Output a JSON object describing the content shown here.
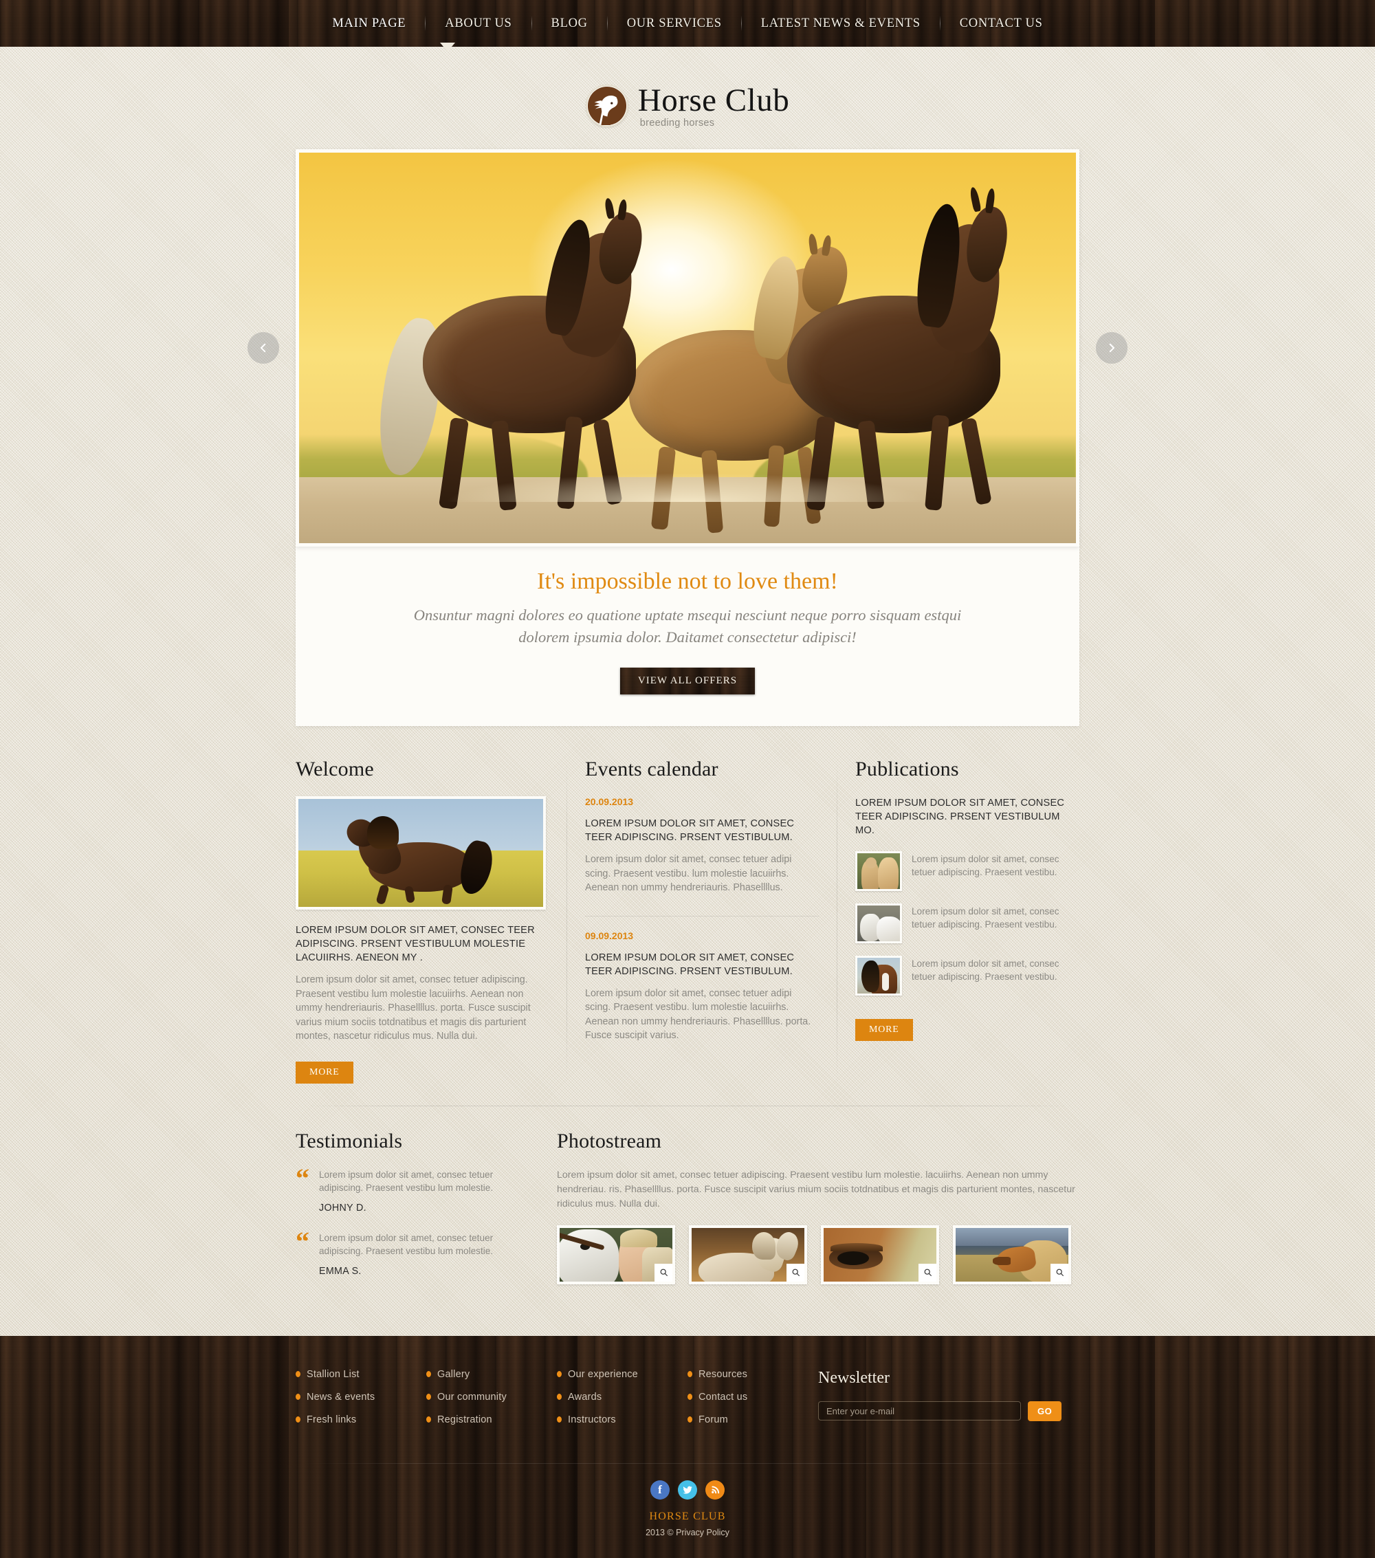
{
  "nav": {
    "items": [
      {
        "label": "MAIN PAGE"
      },
      {
        "label": "ABOUT US"
      },
      {
        "label": "BLOG"
      },
      {
        "label": "OUR SERVICES"
      },
      {
        "label": "LATEST NEWS & EVENTS"
      },
      {
        "label": "CONTACT US"
      }
    ]
  },
  "logo": {
    "title": "Horse Club",
    "tagline": "breeding horses",
    "icon": "horse-head-icon"
  },
  "slider": {
    "prev_icon": "chevron-left-icon",
    "next_icon": "chevron-right-icon",
    "image_alt": "three horses galloping at sunset",
    "caption_title": "It's impossible not to love them!",
    "caption_text": "Onsuntur magni dolores eo quatione uptate msequi nesciunt neque porro sisquam estqui dolorem ipsumia dolor. Daitamet consectetur adipisci!",
    "button_label": "VIEW ALL OFFERS"
  },
  "welcome": {
    "title": "Welcome",
    "image_alt": "brown horse running in a golden field",
    "heading": "LOREM IPSUM DOLOR SIT AMET, CONSEC TEER ADIPISCING. PRSENT VESTIBULUM MOLESTIE LACUIIRHS. AENEON MY .",
    "text": "Lorem ipsum dolor sit amet, consec tetuer adipiscing. Praesent vestibu lum molestie lacuiirhs. Aenean non ummy hendreriauris. Phasellllus. porta. Fusce suscipit varius mium sociis totdnatibus et magis dis parturient montes, nascetur ridiculus mus. Nulla dui.",
    "more_label": "MORE"
  },
  "events": {
    "title": "Events calendar",
    "items": [
      {
        "date": "20.09.2013",
        "heading": "LOREM IPSUM DOLOR SIT AMET, CONSEC TEER ADIPISCING. PRSENT VESTIBULUM.",
        "text": "Lorem ipsum dolor sit amet, consec tetuer adipi scing. Praesent vestibu.  lum molestie lacuiirhs. Aenean non ummy hendreriauris. Phasellllus."
      },
      {
        "date": "09.09.2013",
        "heading": "LOREM IPSUM DOLOR SIT AMET, CONSEC TEER ADIPISCING. PRSENT VESTIBULUM.",
        "text": "Lorem ipsum dolor sit amet, consec tetuer adipi scing. Praesent vestibu.  lum molestie lacuiirhs. Aenean non ummy hendreriauris. Phasellllus. porta. Fusce suscipit varius."
      }
    ]
  },
  "publications": {
    "title": "Publications",
    "heading": "LOREM IPSUM DOLOR SIT AMET, CONSEC TEER ADIPISCING. PRSENT VESTIBULUM MO.",
    "items": [
      {
        "image_alt": "two palomino ponies",
        "text": "Lorem ipsum dolor sit amet, consec tetuer adipiscing. Praesent vestibu."
      },
      {
        "image_alt": "two white horses rearing",
        "text": "Lorem ipsum dolor sit amet, consec tetuer adipiscing. Praesent vestibu."
      },
      {
        "image_alt": "bay horse with black mane",
        "text": "Lorem ipsum dolor sit amet, consec tetuer adipiscing. Praesent vestibu."
      }
    ],
    "more_label": "MORE"
  },
  "testimonials": {
    "title": "Testimonials",
    "items": [
      {
        "text": "Lorem ipsum dolor sit amet, consec tetuer adipiscing. Praesent vestibu lum molestie.",
        "author": "JOHNY D."
      },
      {
        "text": "Lorem ipsum dolor sit amet, consec tetuer adipiscing. Praesent vestibu lum molestie.",
        "author": "EMMA S."
      }
    ]
  },
  "photostream": {
    "title": "Photostream",
    "intro": "Lorem ipsum dolor sit amet, consec tetuer adipiscing. Praesent vestibu lum molestie. lacuiirhs. Aenean non ummy hendreriau. ris. Phasellllus. porta. Fusce suscipit varius mium sociis totdnatibus et magis dis parturient montes, nascetur ridiculus mus. Nulla dui.",
    "items": [
      {
        "image_alt": "woman hugging a white horse",
        "zoom_icon": "magnifier-icon"
      },
      {
        "image_alt": "white horse galloping at sunset",
        "zoom_icon": "magnifier-icon"
      },
      {
        "image_alt": "close-up of a horse eye",
        "zoom_icon": "magnifier-icon"
      },
      {
        "image_alt": "chestnut horse in a plain",
        "zoom_icon": "magnifier-icon"
      }
    ]
  },
  "footer": {
    "link_columns": [
      [
        {
          "label": "Stallion List"
        },
        {
          "label": "News & events"
        },
        {
          "label": "Fresh links"
        }
      ],
      [
        {
          "label": "Gallery"
        },
        {
          "label": "Our community"
        },
        {
          "label": "Registration"
        }
      ],
      [
        {
          "label": "Our experience"
        },
        {
          "label": "Awards"
        },
        {
          "label": "Instructors"
        }
      ],
      [
        {
          "label": "Resources"
        },
        {
          "label": "Contact us"
        },
        {
          "label": "Forum"
        }
      ]
    ],
    "newsletter": {
      "title": "Newsletter",
      "placeholder": "Enter your e-mail",
      "value": "",
      "button_label": "GO"
    },
    "socials": [
      {
        "name": "facebook-icon",
        "glyph": "f",
        "color": "#4a77c4"
      },
      {
        "name": "twitter-icon",
        "glyph": "t",
        "color": "#45c0e8"
      },
      {
        "name": "rss-icon",
        "glyph": "rss",
        "color": "#f08a17"
      }
    ],
    "brand": "HORSE CLUB",
    "copyright": "2013 © Privacy Policy"
  },
  "colors": {
    "accent_orange": "#dd8510",
    "accent_orange_bright": "#ef8f17",
    "paper": "#efeade",
    "wood_dark": "#2b1d14",
    "text_muted": "#8c8a84"
  }
}
